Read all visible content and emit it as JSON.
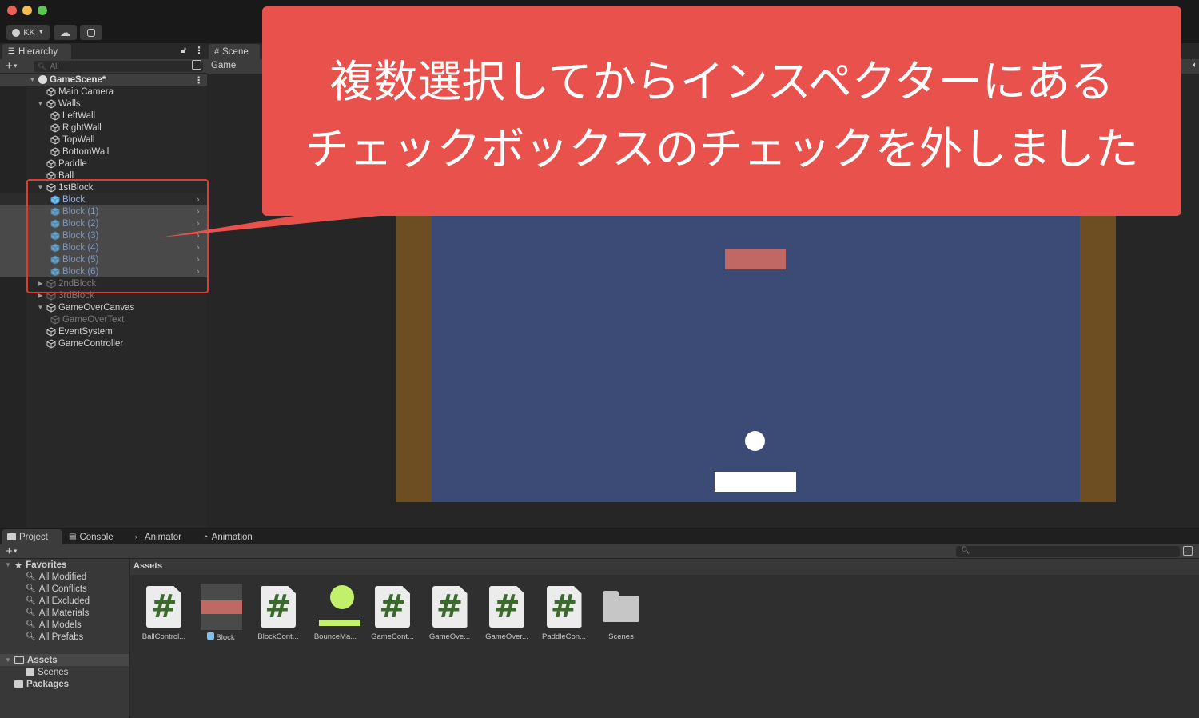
{
  "toolbar": {
    "account_label": "KK",
    "cloud_icon": "cloud-icon",
    "services_icon": "services-icon"
  },
  "hierarchy": {
    "tab_label": "Hierarchy",
    "search_placeholder": "All",
    "scene_name": "GameScene*",
    "items": [
      {
        "label": "Main Camera",
        "depth": 1,
        "state": "normal"
      },
      {
        "label": "Walls",
        "depth": 1,
        "state": "normal",
        "expanded": true
      },
      {
        "label": "LeftWall",
        "depth": 2,
        "state": "normal"
      },
      {
        "label": "RightWall",
        "depth": 2,
        "state": "normal"
      },
      {
        "label": "TopWall",
        "depth": 2,
        "state": "normal"
      },
      {
        "label": "BottomWall",
        "depth": 2,
        "state": "normal"
      },
      {
        "label": "Paddle",
        "depth": 1,
        "state": "normal"
      },
      {
        "label": "Ball",
        "depth": 1,
        "state": "normal"
      },
      {
        "label": "1stBlock",
        "depth": 1,
        "state": "normal",
        "expanded": true
      },
      {
        "label": "Block",
        "depth": 2,
        "state": "prefab-selected"
      },
      {
        "label": "Block (1)",
        "depth": 2,
        "state": "prefab-selected-disabled"
      },
      {
        "label": "Block (2)",
        "depth": 2,
        "state": "prefab-selected-disabled"
      },
      {
        "label": "Block (3)",
        "depth": 2,
        "state": "prefab-selected-disabled"
      },
      {
        "label": "Block (4)",
        "depth": 2,
        "state": "prefab-selected-disabled"
      },
      {
        "label": "Block (5)",
        "depth": 2,
        "state": "prefab-selected-disabled"
      },
      {
        "label": "Block (6)",
        "depth": 2,
        "state": "prefab-selected-disabled"
      },
      {
        "label": "2ndBlock",
        "depth": 1,
        "state": "disabled",
        "collapsed": true
      },
      {
        "label": "3rdBlock",
        "depth": 1,
        "state": "disabled",
        "collapsed": true
      },
      {
        "label": "GameOverCanvas",
        "depth": 1,
        "state": "normal",
        "expanded": true
      },
      {
        "label": "GameOverText",
        "depth": 2,
        "state": "disabled"
      },
      {
        "label": "EventSystem",
        "depth": 1,
        "state": "normal"
      },
      {
        "label": "GameController",
        "depth": 1,
        "state": "normal"
      }
    ]
  },
  "view": {
    "scene_tab": "Scene",
    "game_tab": "Game"
  },
  "callout": {
    "line1": "複数選択してからインスペクターにある",
    "line2": "チェックボックスのチェックを外しました",
    "color": "#e9514c"
  },
  "game": {
    "background": "#3c4b75",
    "wall_color": "#6d4e22",
    "block_color": "#c06964",
    "ball_color": "#ffffff",
    "paddle_color": "#ffffff"
  },
  "bottom": {
    "tabs": [
      "Project",
      "Console",
      "Animator",
      "Animation"
    ],
    "favorites_label": "Favorites",
    "favorites": [
      "All Modified",
      "All Conflicts",
      "All Excluded",
      "All Materials",
      "All Models",
      "All Prefabs"
    ],
    "assets_label": "Assets",
    "assets_children": [
      "Scenes"
    ],
    "packages_label": "Packages",
    "breadcrumb": "Assets",
    "assets": [
      {
        "label": "BallControl...",
        "type": "script"
      },
      {
        "label": "Block",
        "type": "prefab"
      },
      {
        "label": "BlockCont...",
        "type": "script"
      },
      {
        "label": "BounceMa...",
        "type": "physics-material"
      },
      {
        "label": "GameCont...",
        "type": "script"
      },
      {
        "label": "GameOve...",
        "type": "script"
      },
      {
        "label": "GameOver...",
        "type": "script"
      },
      {
        "label": "PaddleCon...",
        "type": "script"
      },
      {
        "label": "Scenes",
        "type": "folder"
      }
    ]
  }
}
